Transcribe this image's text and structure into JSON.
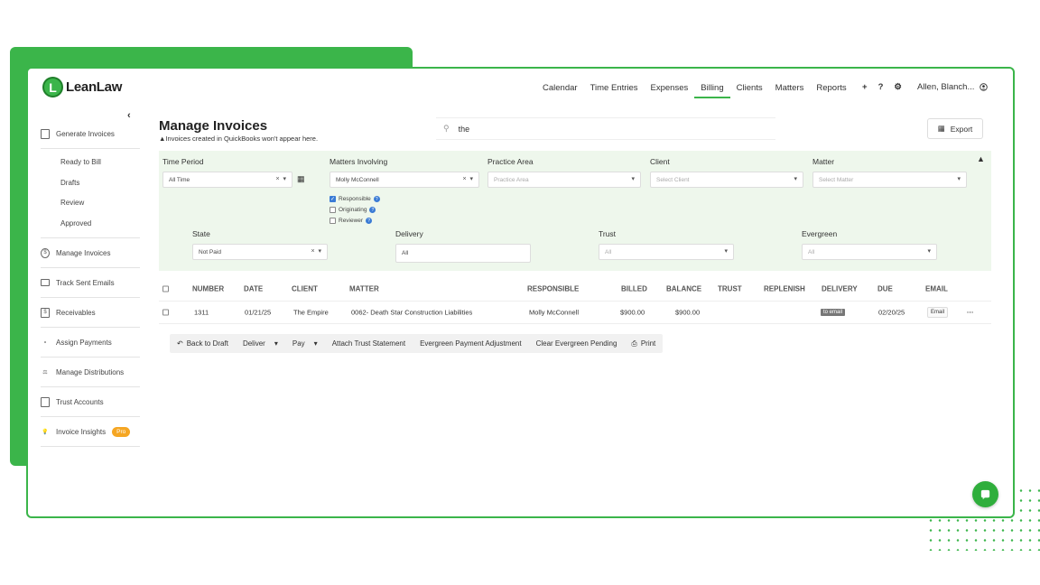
{
  "app": {
    "logo_letter": "L",
    "logo_text": "LeanLaw",
    "brand_color": "#3bb54a"
  },
  "nav": {
    "items": [
      {
        "label": "Calendar"
      },
      {
        "label": "Time Entries"
      },
      {
        "label": "Expenses"
      },
      {
        "label": "Billing",
        "active": true
      },
      {
        "label": "Clients"
      },
      {
        "label": "Matters"
      },
      {
        "label": "Reports"
      }
    ],
    "plus": "+",
    "help": "?",
    "gear": "⚙",
    "user": "Allen, Blanch..."
  },
  "sidebar": {
    "collapse_icon": "‹",
    "generate": "Generate Invoices",
    "sub": [
      "Ready to Bill",
      "Drafts",
      "Review",
      "Approved"
    ],
    "items": [
      {
        "label": "Manage Invoices",
        "icon": "dollar-circle-icon"
      },
      {
        "label": "Track Sent Emails",
        "icon": "envelope-icon"
      },
      {
        "label": "Receivables",
        "icon": "document-dollar-icon"
      },
      {
        "label": "Assign Payments",
        "icon": "flow-icon"
      },
      {
        "label": "Manage Distributions",
        "icon": "scale-icon"
      },
      {
        "label": "Trust Accounts",
        "icon": "lock-icon"
      },
      {
        "label": "Invoice Insights",
        "icon": "lightbulb-icon",
        "badge": "Pro"
      }
    ]
  },
  "main": {
    "title": "Manage Invoices",
    "subtitle": "Invoices created in QuickBooks won't appear here.",
    "search_value": "the",
    "export_label": "Export"
  },
  "filters": {
    "time_period": {
      "label": "Time Period",
      "value": "All Time"
    },
    "matters_involving": {
      "label": "Matters Involving",
      "value": "Molly McConnell"
    },
    "practice_area": {
      "label": "Practice Area",
      "placeholder": "Practice Area"
    },
    "client": {
      "label": "Client",
      "placeholder": "Select Client"
    },
    "matter": {
      "label": "Matter",
      "placeholder": "Select Matter"
    },
    "roles": [
      {
        "label": "Responsible",
        "checked": true
      },
      {
        "label": "Originating",
        "checked": false
      },
      {
        "label": "Reviewer",
        "checked": false
      }
    ],
    "state": {
      "label": "State",
      "value": "Not Paid"
    },
    "delivery": {
      "label": "Delivery",
      "value": "All"
    },
    "trust": {
      "label": "Trust",
      "value": "All"
    },
    "evergreen": {
      "label": "Evergreen",
      "value": "All"
    }
  },
  "table": {
    "headers": [
      "NUMBER",
      "DATE",
      "CLIENT",
      "MATTER",
      "RESPONSIBLE",
      "BILLED",
      "BALANCE",
      "TRUST",
      "REPLENISH",
      "DELIVERY",
      "DUE",
      "EMAIL"
    ],
    "rows": [
      {
        "number": "1311",
        "date": "01/21/25",
        "client": "The Empire",
        "matter": "0062- Death Star Construction Liabilities",
        "responsible": "Molly McConnell",
        "billed": "$900.00",
        "balance": "$900.00",
        "trust": "",
        "replenish": "",
        "delivery": "to email",
        "due": "02/20/25",
        "email": "Email"
      }
    ]
  },
  "actions": {
    "back_to_draft": "Back to Draft",
    "deliver": "Deliver",
    "pay": "Pay",
    "attach_trust": "Attach Trust Statement",
    "evergreen_adj": "Evergreen Payment Adjustment",
    "clear_evergreen": "Clear Evergreen Pending",
    "print": "Print"
  }
}
